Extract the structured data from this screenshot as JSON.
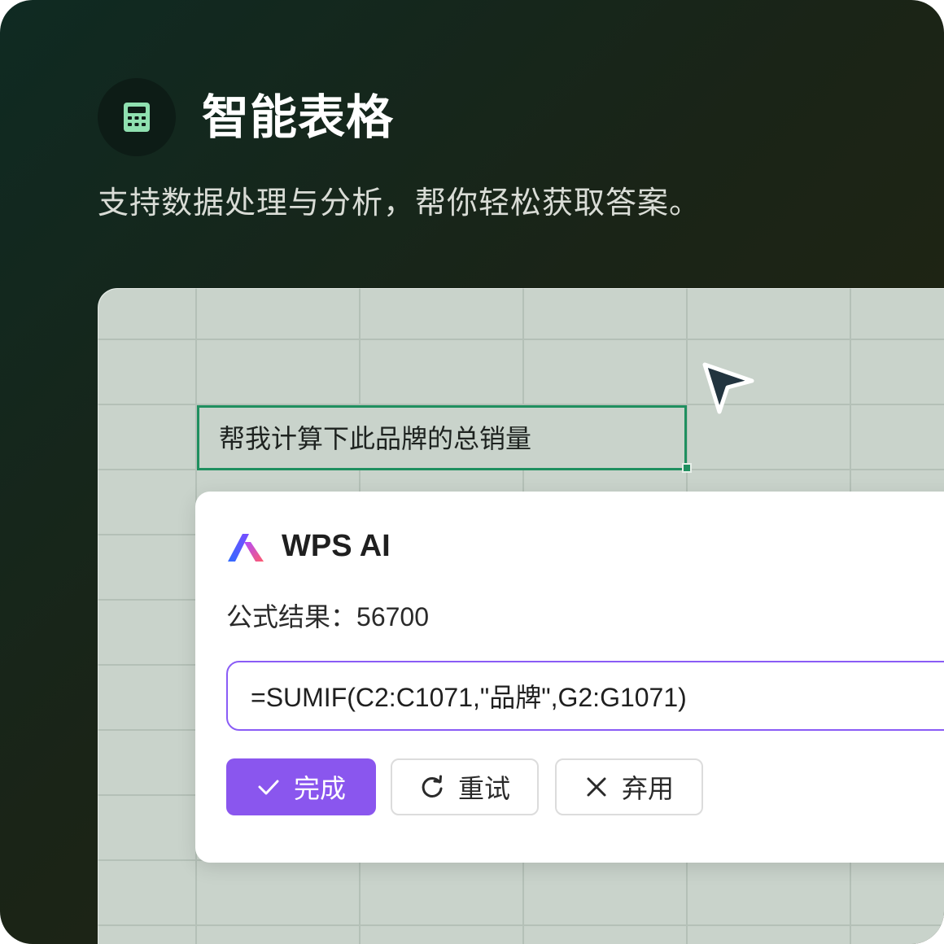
{
  "header": {
    "icon": "calculator-icon",
    "title": "智能表格",
    "subtitle": "支持数据处理与分析，帮你轻松获取答案。"
  },
  "sheet": {
    "selected_cell_text": "帮我计算下此品牌的总销量"
  },
  "panel": {
    "brand": "WPS AI",
    "result_label": "公式结果：",
    "result_value": "56700",
    "formula": "=SUMIF(C2:C1071,\"品牌\",G2:G1071)",
    "buttons": {
      "done": "完成",
      "retry": "重试",
      "discard": "弃用"
    }
  },
  "colors": {
    "accent_purple": "#8a56ee",
    "selection_green": "#1f8f5f",
    "background_dark": "#0f2a22"
  }
}
